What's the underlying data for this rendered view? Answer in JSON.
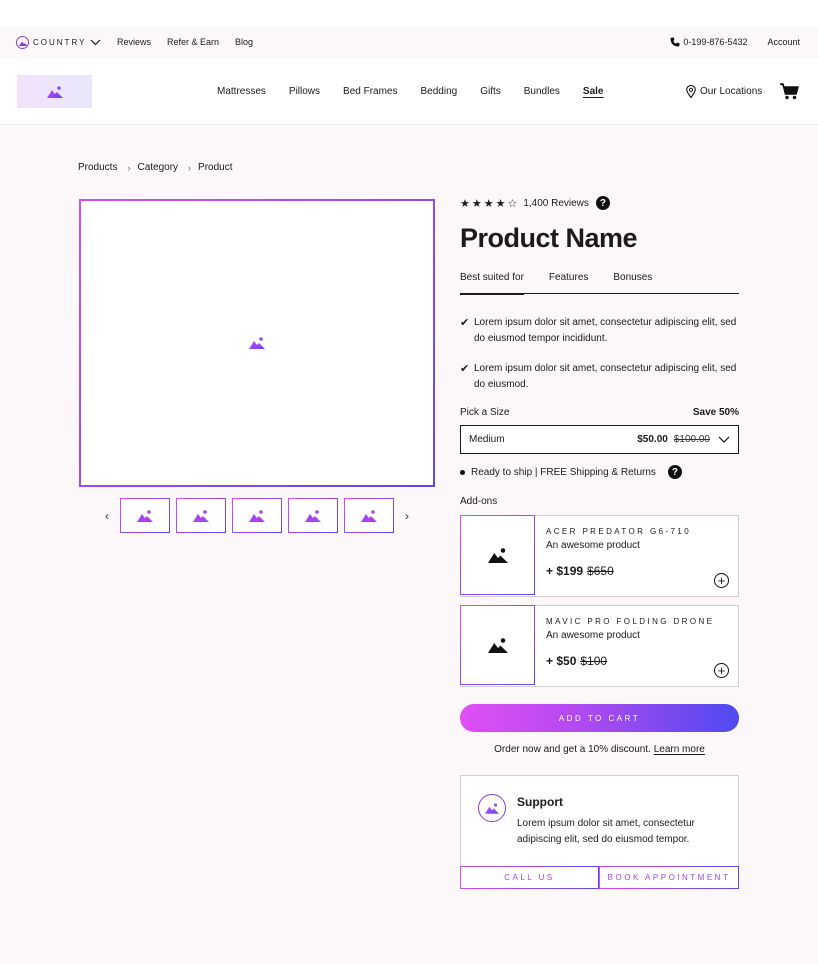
{
  "topbar": {
    "country_label": "COUNTRY",
    "links": [
      "Reviews",
      "Refer & Earn",
      "Blog"
    ],
    "phone": "0-199-876-5432",
    "account": "Account"
  },
  "nav": {
    "links": [
      "Mattresses",
      "Pillows",
      "Bed Frames",
      "Bedding",
      "Gifts",
      "Bundles"
    ],
    "sale": "Sale",
    "locations": "Our Locations"
  },
  "breadcrumb": [
    "Products",
    "Category",
    "Product"
  ],
  "product": {
    "rating_stars": 4.5,
    "reviews": "1,400 Reviews",
    "name": "Product Name",
    "tabs": [
      "Best suited for",
      "Features",
      "Bonuses"
    ],
    "bullets": [
      "Lorem ipsum dolor sit amet, consectetur adipiscing elit, sed do eiusmod tempor incididunt.",
      "Lorem ipsum dolor sit amet, consectetur adipiscing elit, sed do eiusmod."
    ],
    "size_label": "Pick a Size",
    "save_label": "Save 50%",
    "size_value": "Medium",
    "price": "$50.00",
    "was_price": "$100.00",
    "shipping": "Ready to ship | FREE Shipping & Returns"
  },
  "addons": {
    "label": "Add-ons",
    "items": [
      {
        "title": "ACER PREDATOR G6-710",
        "subtitle": "An awesome product",
        "price": "+ $199",
        "was": "$650"
      },
      {
        "title": "MAVIC PRO FOLDING DRONE",
        "subtitle": "An awesome product",
        "price": "+ $50",
        "was": "$100"
      }
    ]
  },
  "cta": {
    "add_to_cart": "ADD TO CART",
    "discount_text": "Order now and get a 10% discount.",
    "learn_more": "Learn more"
  },
  "support": {
    "title": "Support",
    "description": "Lorem ipsum dolor sit amet, consectetur adipiscing elit, sed do eiusmod tempor.",
    "call": "CALL US",
    "book": "BOOK APPOINTMENT"
  },
  "colors": {
    "accent_start": "#e04ff4",
    "accent_end": "#4f4af0"
  }
}
